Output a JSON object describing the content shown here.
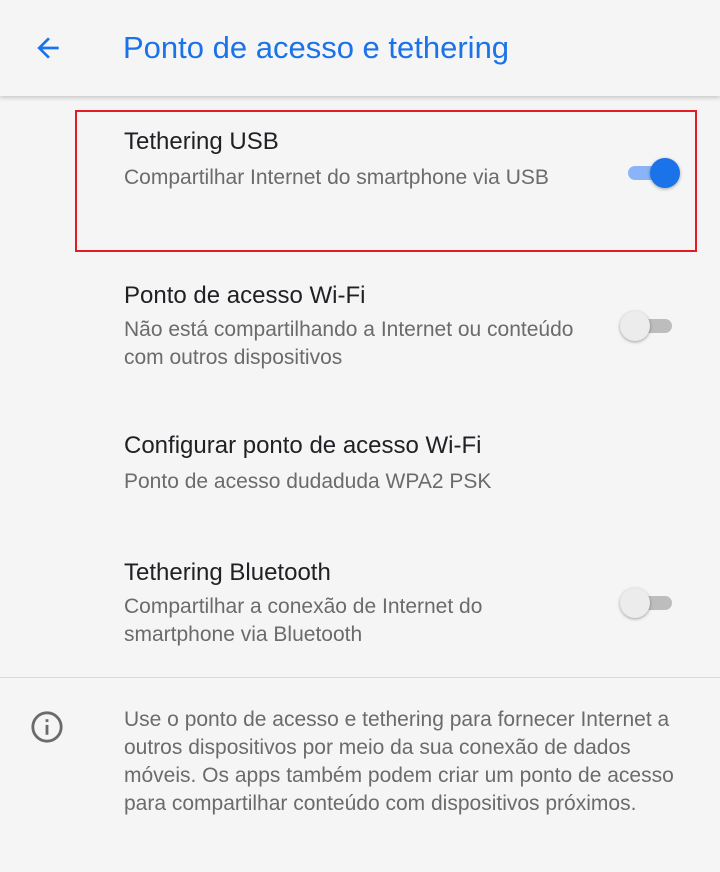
{
  "app_bar": {
    "title": "Ponto de acesso e tethering",
    "back_icon": "arrow-back-icon"
  },
  "colors": {
    "accent": "#1a73e8",
    "highlight": "#e31b23",
    "background": "#f5f5f5"
  },
  "preferences": [
    {
      "title": "Tethering USB",
      "summary": "Compartilhar Internet do smartphone via USB",
      "switch_on": true
    },
    {
      "title": "Ponto de acesso Wi-Fi",
      "summary": "Não está compartilhando a Internet ou conteúdo com outros dispositivos",
      "switch_on": false
    },
    {
      "title": "Configurar ponto de acesso Wi-Fi",
      "summary": "Ponto de acesso dudaduda WPA2 PSK"
    },
    {
      "title": "Tethering Bluetooth",
      "summary": "Compartilhar a conexão de Internet do smartphone via Bluetooth",
      "switch_on": false
    }
  ],
  "footer": {
    "icon": "info-icon",
    "text": "Use o ponto de acesso e tethering para fornecer Internet a outros dispositivos por meio da sua conexão de dados móveis. Os apps também podem criar um ponto de acesso para compartilhar conteúdo com dispositivos próximos."
  }
}
